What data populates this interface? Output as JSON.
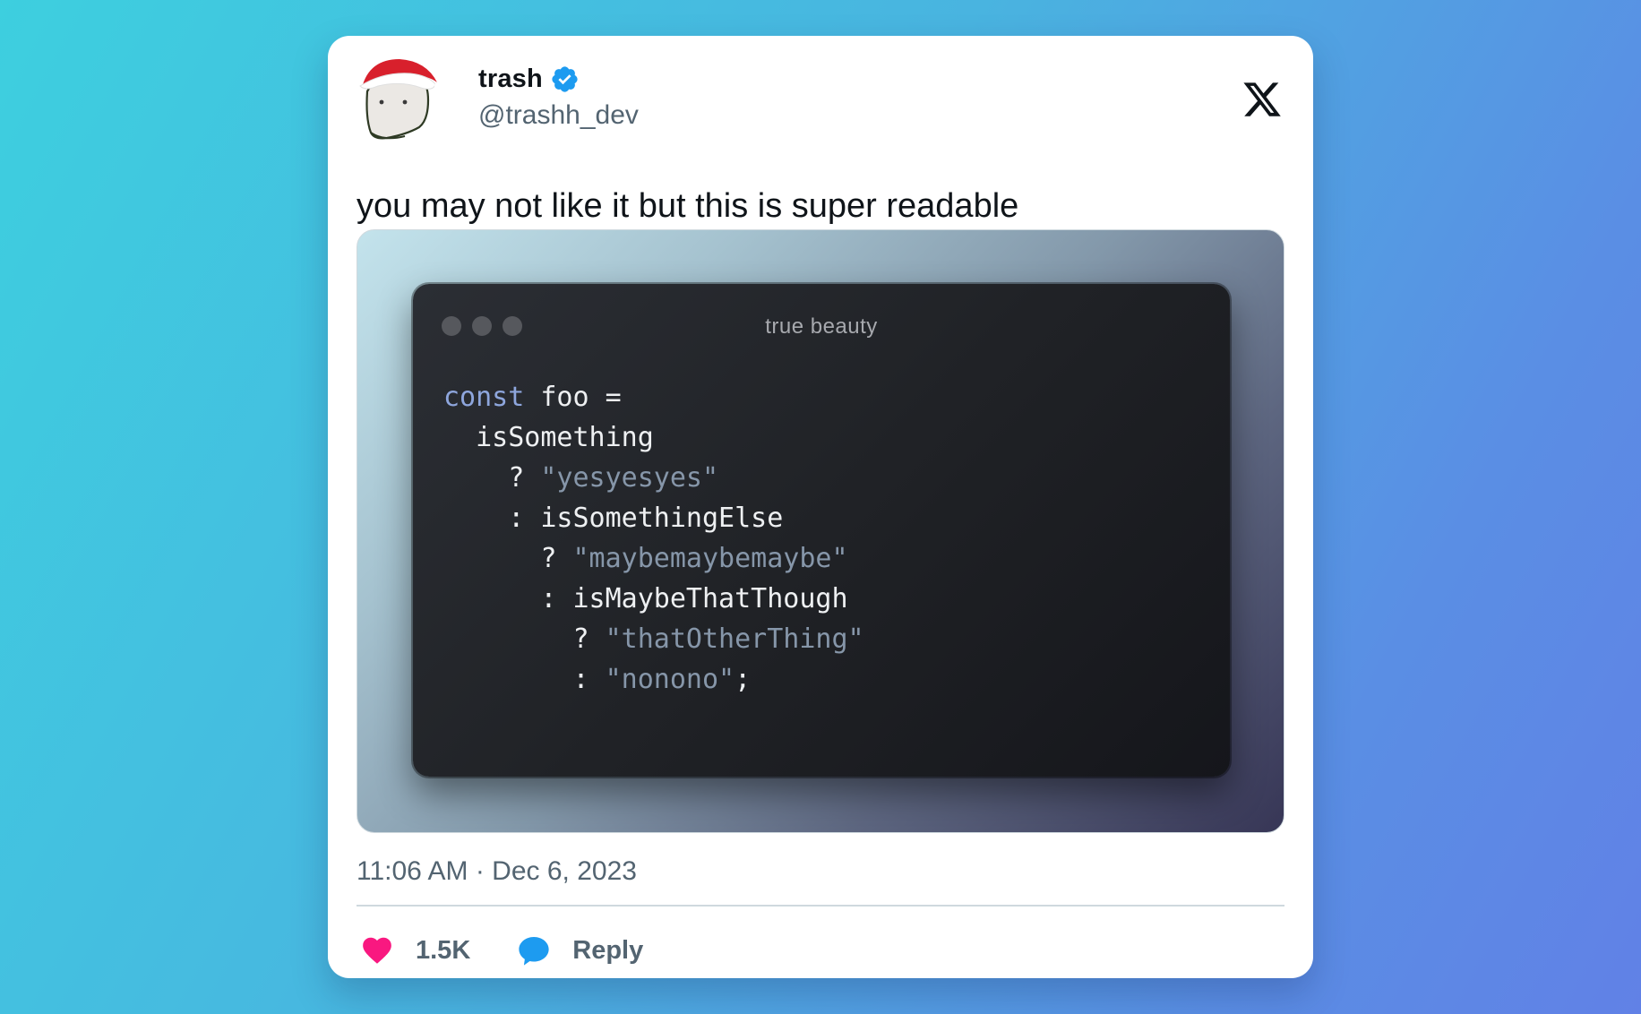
{
  "author": {
    "display_name": "trash",
    "handle": "@trashh_dev",
    "verified": true,
    "avatar_icon": "marshmallow-santa-hat-avatar"
  },
  "brand_icon": "x-logo-icon",
  "tweet": {
    "text": "you may not like it but this is super readable",
    "timestamp": "11:06 AM · Dec 6, 2023"
  },
  "media": {
    "window_title": "true beauty",
    "code_lines": [
      "const foo =",
      "  isSomething",
      "    ? \"yesyesyes\"",
      "    : isSomethingElse",
      "      ? \"maybemaybemaybe\"",
      "      : isMaybeThatThough",
      "        ? \"thatOtherThing\"",
      "        : \"nonono\";"
    ]
  },
  "actions": {
    "like_count": "1.5K",
    "reply_label": "Reply"
  },
  "colors": {
    "verified_blue": "#1d9bf0",
    "like_pink": "#f91880",
    "reply_blue": "#1d9bf0",
    "keyword": "#8ea6dd",
    "string": "#8696a9"
  }
}
